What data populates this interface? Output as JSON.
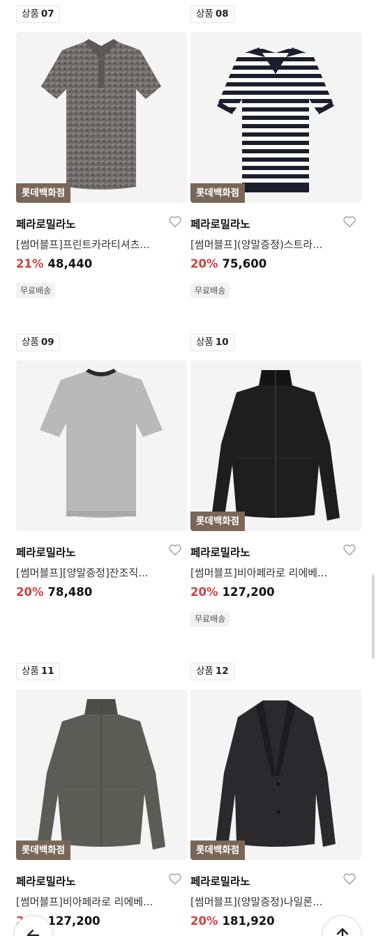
{
  "products": [
    {
      "rank_label": "상품",
      "rank_num": "07",
      "store": "롯데백화점",
      "brand": "페라로밀라노",
      "name": "[썸머블프]프린트카라티셔츠...",
      "discount": "21%",
      "price": "48,440",
      "shipping": "무료배송",
      "image": "printed-polo-shirt"
    },
    {
      "rank_label": "상품",
      "rank_num": "08",
      "store": "롯데백화점",
      "brand": "페라로밀라노",
      "name": "[썸머블프](양말증정)스트라...",
      "discount": "20%",
      "price": "75,600",
      "shipping": "무료배송",
      "image": "striped-polo-shirt"
    },
    {
      "rank_label": "상품",
      "rank_num": "09",
      "store": "",
      "brand": "페라로밀라노",
      "name": "[썸머블프][양말증정]잔조직...",
      "discount": "20%",
      "price": "78,480",
      "shipping": "",
      "image": "grey-knit-tee"
    },
    {
      "rank_label": "상품",
      "rank_num": "10",
      "store": "롯데백화점",
      "brand": "페라로밀라노",
      "name": "[썸머블프]비아페라로 리에베...",
      "discount": "20%",
      "price": "127,200",
      "shipping": "무료배송",
      "image": "black-zip-jacket"
    },
    {
      "rank_label": "상품",
      "rank_num": "11",
      "store": "롯데백화점",
      "brand": "페라로밀라노",
      "name": "[썸머블프]비아페라로 리에베...",
      "discount": "20%",
      "price": "127,200",
      "shipping": "",
      "image": "khaki-zip-jacket"
    },
    {
      "rank_label": "상품",
      "rank_num": "12",
      "store": "롯데백화점",
      "brand": "페라로밀라노",
      "name": "[썸머블프](양말증정)나일론...",
      "discount": "20%",
      "price": "181,920",
      "shipping": "",
      "image": "black-blazer"
    }
  ],
  "floating_buttons": {
    "back_icon": "arrow-left-icon",
    "top_icon": "arrow-up-icon"
  },
  "colors": {
    "discount": "#d23f3f",
    "store_badge": "#7a6757",
    "card_bg": "#f4f4f4"
  }
}
